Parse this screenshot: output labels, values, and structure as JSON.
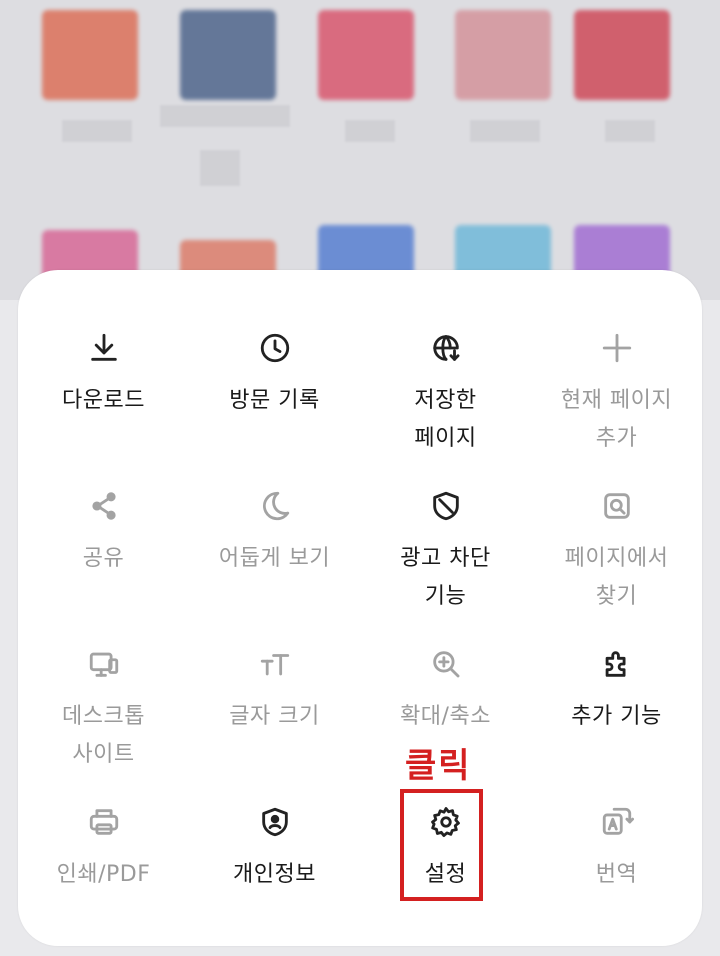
{
  "menu": {
    "items": [
      {
        "label": "다운로드",
        "icon": "download-icon",
        "enabled": true
      },
      {
        "label": "방문 기록",
        "icon": "history-clock-icon",
        "enabled": true
      },
      {
        "label": "저장한\n페이지",
        "icon": "saved-page-globe-icon",
        "enabled": true
      },
      {
        "label": "현재 페이지\n추가",
        "icon": "plus-icon",
        "enabled": false
      },
      {
        "label": "공유",
        "icon": "share-icon",
        "enabled": false
      },
      {
        "label": "어둡게 보기",
        "icon": "moon-icon",
        "enabled": false
      },
      {
        "label": "광고 차단\n기능",
        "icon": "shield-block-icon",
        "enabled": true
      },
      {
        "label": "페이지에서\n찾기",
        "icon": "find-in-page-icon",
        "enabled": false
      },
      {
        "label": "데스크톱\n사이트",
        "icon": "desktop-site-icon",
        "enabled": false
      },
      {
        "label": "글자 크기",
        "icon": "text-size-icon",
        "enabled": false
      },
      {
        "label": "확대/축소",
        "icon": "zoom-icon",
        "enabled": false
      },
      {
        "label": "추가 기능",
        "icon": "puzzle-icon",
        "enabled": true
      },
      {
        "label": "인쇄/PDF",
        "icon": "print-icon",
        "enabled": false
      },
      {
        "label": "개인정보",
        "icon": "privacy-shield-icon",
        "enabled": true
      },
      {
        "label": "설정",
        "icon": "gear-icon",
        "enabled": true
      },
      {
        "label": "번역",
        "icon": "translate-icon",
        "enabled": false
      }
    ]
  },
  "annotation": {
    "text": "클릭",
    "color": "#d42020"
  }
}
